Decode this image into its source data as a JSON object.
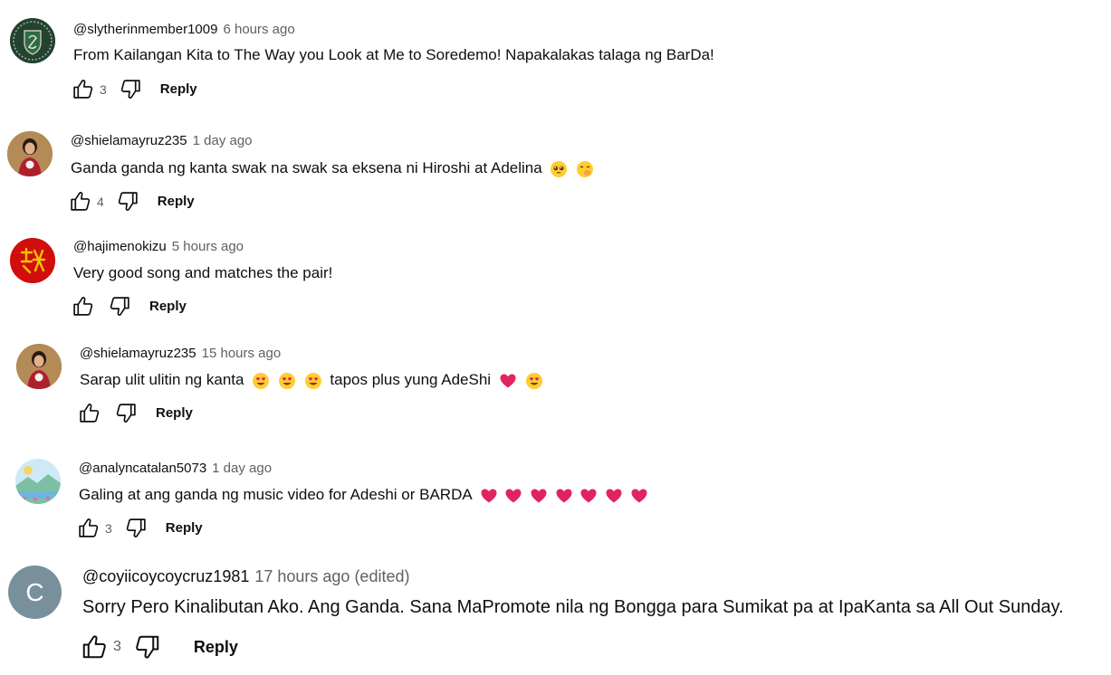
{
  "comments": [
    {
      "handle": "@slytherinmember1009",
      "time": "6 hours ago",
      "text": "From Kailangan Kita to The Way you Look at Me to Soredemo! Napakalakas talaga ng BarDa!",
      "likes": "3",
      "reply_label": "Reply",
      "avatar": "slytherin-crest-avatar"
    },
    {
      "handle": "@shielamayruz235",
      "time": "1 day ago",
      "text": "Ganda ganda ng kanta swak na swak sa eksena ni Hiroshi at Adelina",
      "emojis": [
        "pleading-face",
        "face-with-hand-over-mouth"
      ],
      "likes": "4",
      "reply_label": "Reply",
      "avatar": "woman-photo-avatar"
    },
    {
      "handle": "@hajimenokizu",
      "time": "5 hours ago",
      "text": "Very good song and matches the pair!",
      "likes": "",
      "reply_label": "Reply",
      "avatar": "red-kanji-avatar"
    },
    {
      "handle": "@shielamayruz235",
      "time": "15 hours ago",
      "text_a": "Sarap ulit ulitin ng kanta",
      "emojis_a": [
        "heart-eyes",
        "heart-eyes",
        "heart-eyes"
      ],
      "text_b": "tapos plus yung AdeShi",
      "emojis_b": [
        "red-heart",
        "heart-eyes"
      ],
      "likes": "",
      "reply_label": "Reply",
      "avatar": "woman-photo-avatar"
    },
    {
      "handle": "@analyncatalan5073",
      "time": "1 day ago",
      "text": "Galing at ang ganda ng music video for Adeshi or BARDA",
      "emojis": [
        "red-heart",
        "red-heart",
        "red-heart",
        "red-heart",
        "red-heart",
        "red-heart",
        "red-heart"
      ],
      "likes": "3",
      "reply_label": "Reply",
      "avatar": "landscape-avatar"
    },
    {
      "handle": "@coyiicoycoycruz1981",
      "time": "17 hours ago (edited)",
      "text": "Sorry Pero Kinalibutan Ako. Ang Ganda. Sana MaPromote nila ng Bongga para Sumikat pa at IpaKanta sa All Out Sunday.",
      "likes": "3",
      "reply_label": "Reply",
      "avatar": "letter-avatar",
      "avatar_letter": "C",
      "avatar_color": "#78909c"
    }
  ],
  "colors": {
    "text": "#0f0f0f",
    "meta": "#606060",
    "heart": "#e0245e",
    "emoji_face": "#ffcc33"
  }
}
